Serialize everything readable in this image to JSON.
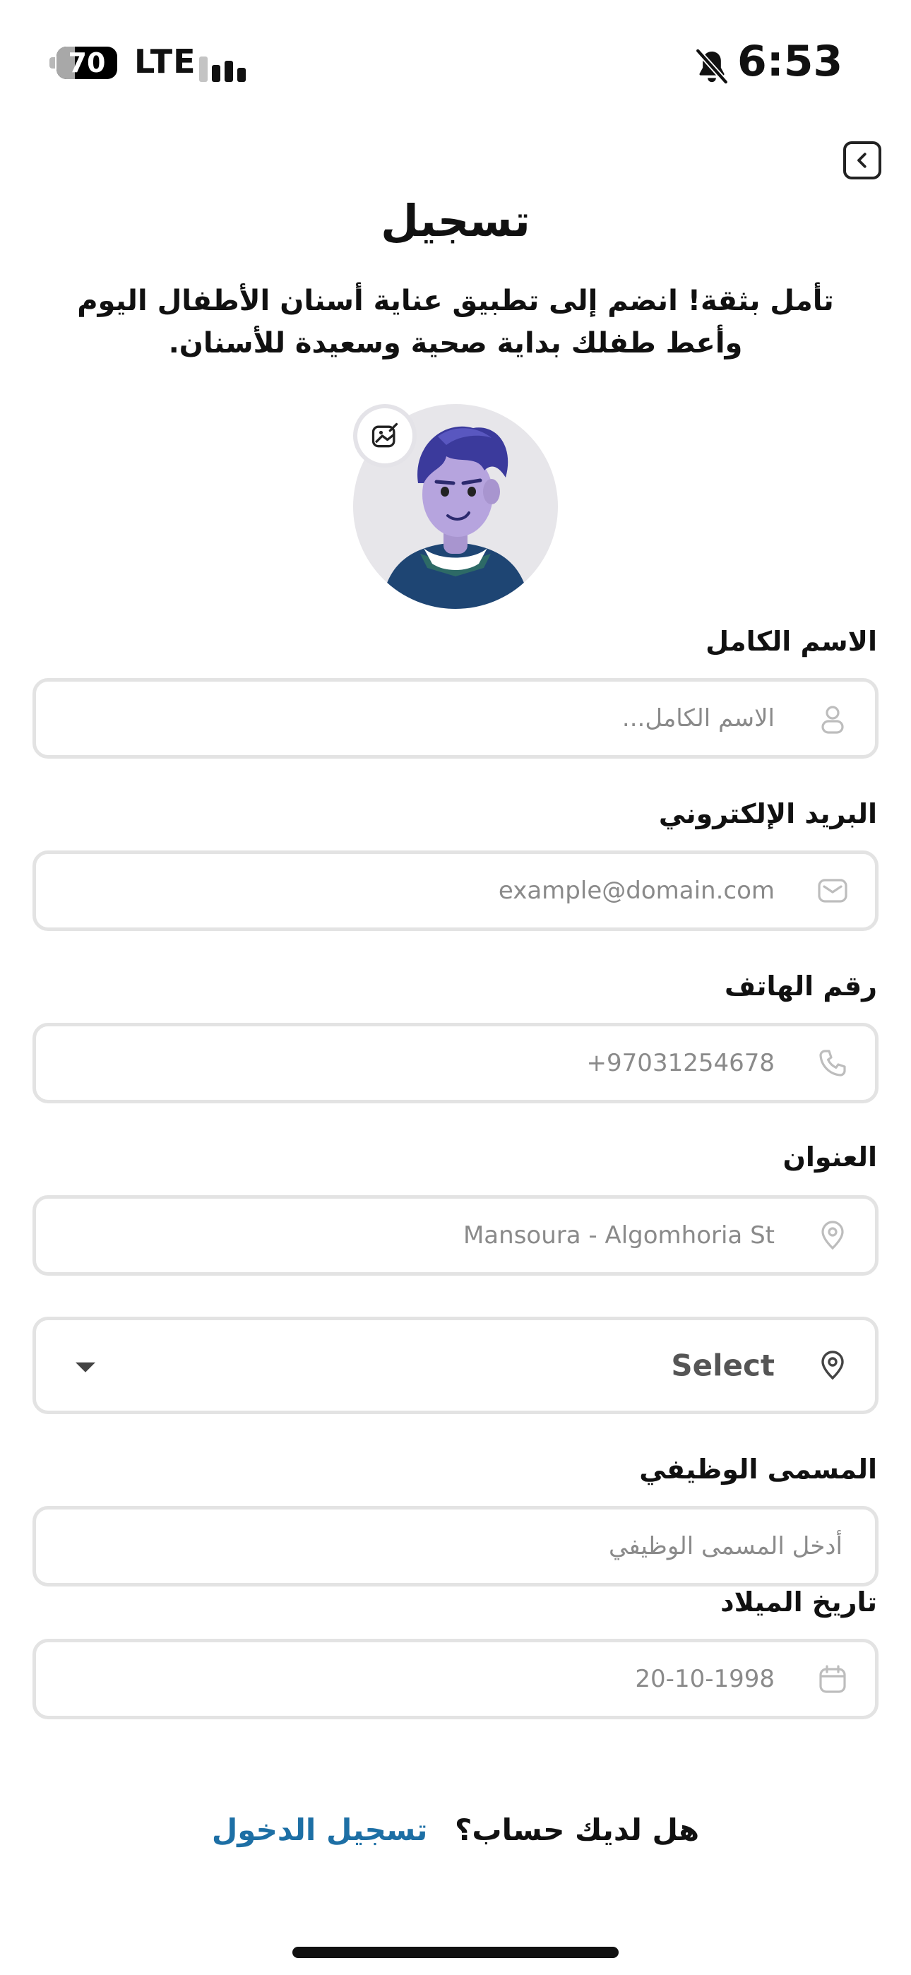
{
  "status_bar": {
    "battery_level": "70",
    "battery_fraction": 0.7,
    "network": "LTE",
    "signal_bars": 3,
    "muted_icon": "bell-slash-icon",
    "time": "6:53"
  },
  "header": {
    "back_icon": "chevron-left-icon",
    "title": "تسجيل",
    "subtitle": "تأمل بثقة! انضم إلى تطبيق عناية أسنان الأطفال اليوم وأعط طفلك بداية صحية وسعيدة للأسنان."
  },
  "avatar": {
    "image": "boy-avatar-illustration",
    "edit_icon": "image-edit-icon"
  },
  "form": {
    "full_name": {
      "label": "الاسم الكامل",
      "placeholder": "الاسم الكامل...",
      "icon": "user-icon"
    },
    "email": {
      "label": "البريد الإلكتروني",
      "placeholder": "example@domain.com",
      "icon": "mail-icon"
    },
    "phone": {
      "label": "رقم الهاتف",
      "placeholder": "97031254678+",
      "icon": "phone-icon"
    },
    "address": {
      "label": "العنوان",
      "placeholder": "Mansoura - Algomhoria St",
      "icon": "location-pin-icon"
    },
    "region_select": {
      "value": "Select",
      "icon": "location-pin-icon"
    },
    "job_title": {
      "label": "المسمى الوظيفي",
      "placeholder": "أدخل المسمى الوظيفي"
    },
    "birth_date": {
      "label": "تاريخ الميلاد",
      "placeholder": "20-10-1998",
      "icon": "calendar-icon"
    }
  },
  "footer": {
    "question": "هل لديك حساب؟",
    "login_link": "تسجيل الدخول"
  },
  "colors": {
    "link": "#1d6fa5",
    "field_border": "#e3e3e3",
    "placeholder": "#8a8a8a",
    "avatar_bg": "#e7e6ea"
  }
}
